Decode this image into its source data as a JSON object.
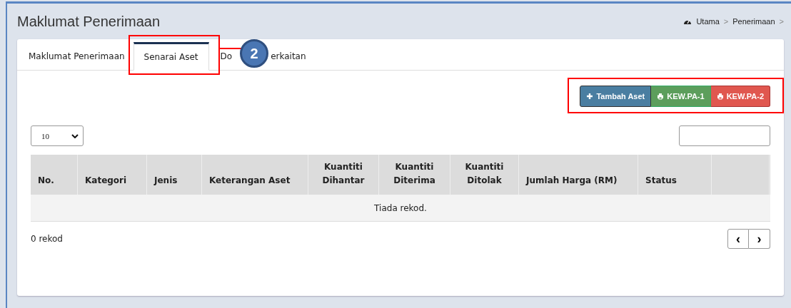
{
  "page_title": "Maklumat Penerimaan",
  "breadcrumb": [
    {
      "label": "Utama"
    },
    {
      "label": "Penerimaan"
    }
  ],
  "breadcrumb_separator": ">",
  "tabs": [
    {
      "label": "Maklumat Penerimaan",
      "selected": false
    },
    {
      "label": "Senarai Aset",
      "selected": true
    },
    {
      "label_parts": [
        "Do",
        "erkaitan"
      ],
      "selected": false
    }
  ],
  "actions": [
    {
      "label": "Tambah Aset",
      "kind": "add"
    },
    {
      "label": "KEW.PA-1",
      "kind": "print-green"
    },
    {
      "label": "KEW.PA-2",
      "kind": "print-red"
    }
  ],
  "page_size": {
    "value": "10"
  },
  "table": {
    "columns": [
      [
        "No."
      ],
      [
        "Kategori"
      ],
      [
        "Jenis"
      ],
      [
        "Keterangan Aset"
      ],
      [
        "Kuantiti",
        "Dihantar"
      ],
      [
        "Kuantiti",
        "Diterima"
      ],
      [
        "Kuantiti",
        "Ditolak"
      ],
      [
        "Jumlah Harga (RM)"
      ],
      [
        "Status"
      ],
      []
    ],
    "empty_message": "Tiada rekod."
  },
  "record_count": "0 rekod",
  "pager": [
    {
      "symbol": "‹",
      "kind": "prev"
    },
    {
      "symbol": "›",
      "kind": "next"
    }
  ],
  "annotation": {
    "number": "2"
  }
}
